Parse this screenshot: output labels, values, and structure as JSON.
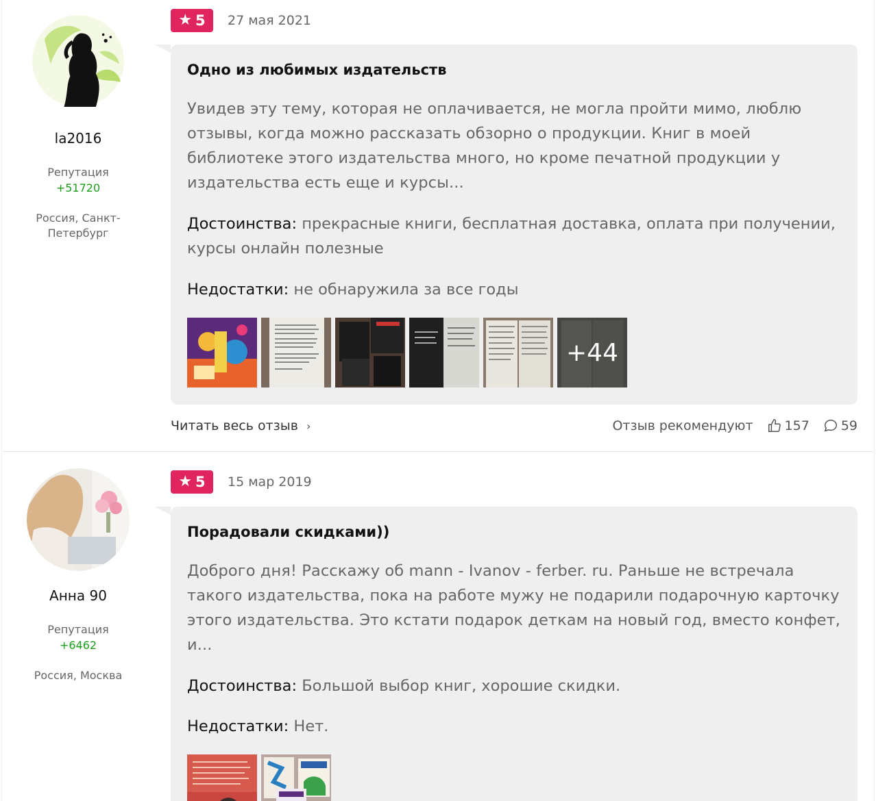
{
  "reviews": [
    {
      "author": {
        "name": "la2016",
        "reputation_label": "Репутация",
        "reputation": "+51720",
        "location": "Россия, Санкт-Петербург"
      },
      "rating": "5",
      "date": "27 мая 2021",
      "title": "Одно из любимых издательств",
      "text": "Увидев эту тему, которая не оплачивается, не могла пройти мимо, люблю отзывы, когда можно рассказать обзорно о продукции. Книг в моей библиотеке этого издательства много, но кроме печатной продукции у издательства есть еще и курсы...",
      "pros_label": "Достоинства:",
      "pros": "прекрасные книги, бесплатная доставка, оплата при получении, курсы онлайн полезные",
      "cons_label": "Недостатки:",
      "cons": "не обнаружила за все годы",
      "more_photos": "+44",
      "read_more": "Читать весь отзыв",
      "recommend_label": "Отзыв рекомендуют",
      "likes": "157",
      "comments": "59"
    },
    {
      "author": {
        "name": "Анна 90",
        "reputation_label": "Репутация",
        "reputation": "+6462",
        "location": "Россия, Москва"
      },
      "rating": "5",
      "date": "15 мар 2019",
      "title": "Порадовали скидками))",
      "text": "Доброго дня! Расскажу об mann - Ivanov - ferber. ru. Раньше не встречала такого издательства, пока на работе мужу не подарили подарочную карточку этого издательства. Это кстати подарок деткам на новый год, вместо конфет, и...",
      "pros_label": "Достоинства:",
      "pros": "Большой выбор книг, хорошие скидки.",
      "cons_label": "Недостатки:",
      "cons": "Нет."
    }
  ],
  "colors": {
    "rating_badge": "#e0245e",
    "reputation": "#1a9e1a",
    "bubble": "#efefef"
  }
}
